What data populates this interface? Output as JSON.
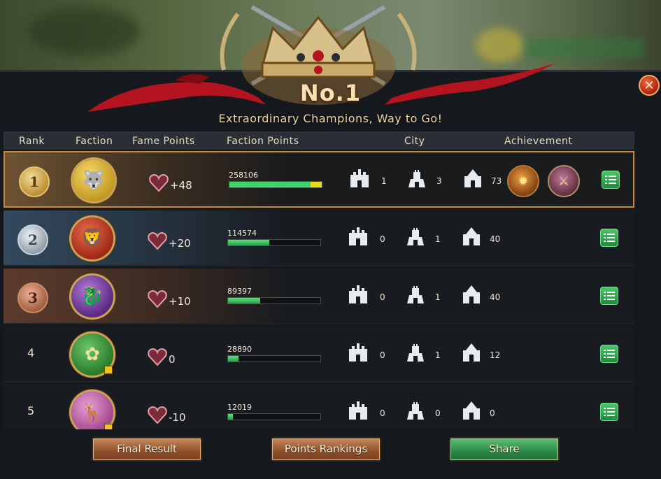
{
  "header": {
    "title": "No.1",
    "subtitle": "Extraordinary Champions, Way to Go!"
  },
  "columns": {
    "rank": "Rank",
    "faction": "Faction",
    "fame_points": "Fame Points",
    "faction_points": "Faction Points",
    "city": "City",
    "achievement": "Achievement"
  },
  "rows": [
    {
      "rank": "1",
      "faction": "stark-wolf-icon",
      "fame": "+48",
      "faction_points": "258106",
      "progress": 1.0,
      "city_a": "1",
      "city_b": "3",
      "city_c": "73"
    },
    {
      "rank": "2",
      "faction": "lannister-lion-icon",
      "fame": "+20",
      "faction_points": "114574",
      "progress": 0.45,
      "city_a": "0",
      "city_b": "1",
      "city_c": "40"
    },
    {
      "rank": "3",
      "faction": "targaryen-dragon-icon",
      "fame": "+10",
      "faction_points": "89397",
      "progress": 0.35,
      "city_a": "0",
      "city_b": "1",
      "city_c": "40"
    },
    {
      "rank": "4",
      "faction": "tyrell-rose-icon",
      "fame": "0",
      "faction_points": "28890",
      "progress": 0.11,
      "city_a": "0",
      "city_b": "1",
      "city_c": "12"
    },
    {
      "rank": "5",
      "faction": "baratheon-stag-icon",
      "fame": "-10",
      "faction_points": "12019",
      "progress": 0.05,
      "city_a": "0",
      "city_b": "0",
      "city_c": "0"
    }
  ],
  "buttons": {
    "final_result": "Final Result",
    "points_rankings": "Points Rankings",
    "share": "Share"
  },
  "colors": {
    "gold_border": "#c98a3e",
    "progress_green": "#3fd56a",
    "share_green": "#2c8a46",
    "brown_button": "#8e4f2a"
  }
}
